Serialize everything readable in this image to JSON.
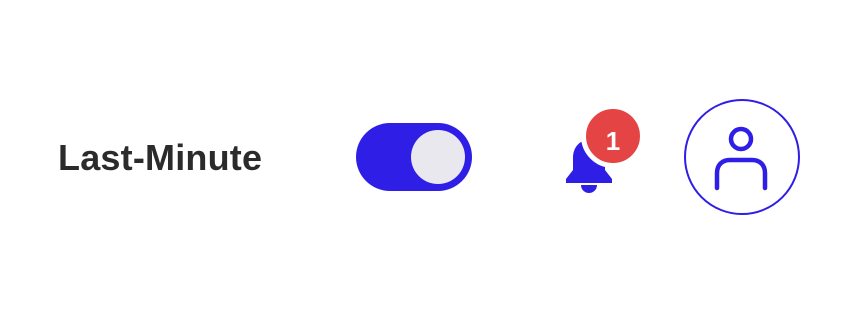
{
  "header": {
    "last_minute_label": "Last-Minute",
    "last_minute_toggle_on": true,
    "notifications": {
      "count": "1",
      "icon": "bell-icon"
    },
    "avatar_icon": "user-icon"
  },
  "colors": {
    "accent": "#2f1ee6",
    "badge": "#e54444",
    "text": "#2b2b2b",
    "knob": "#e8e8ee"
  }
}
